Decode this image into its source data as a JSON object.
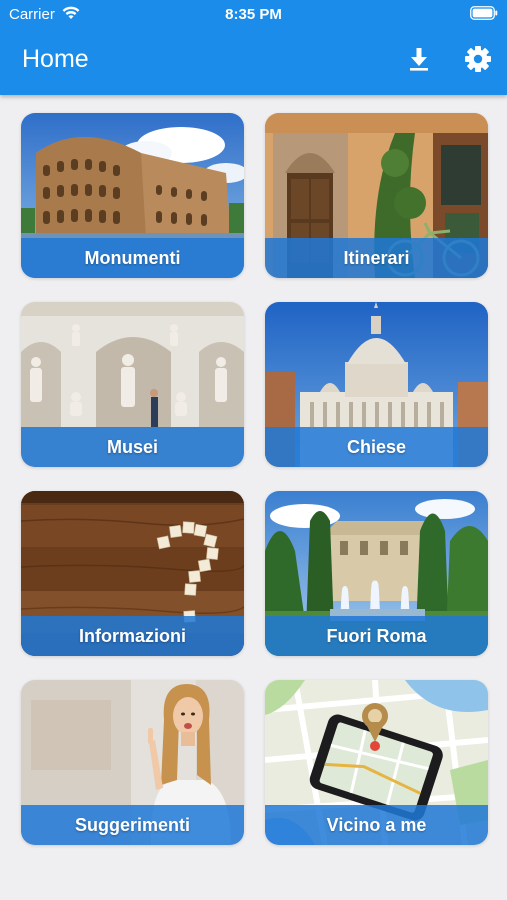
{
  "status_bar": {
    "carrier": "Carrier",
    "time": "8:35 PM"
  },
  "header": {
    "title": "Home",
    "download_icon": "download-icon",
    "settings_icon": "gear-icon"
  },
  "colors": {
    "header": "#1b8ce9",
    "tile_band": "#1e78d7",
    "background": "#efeff1"
  },
  "tiles": [
    {
      "label": "Monumenti",
      "image": "colosseum-image"
    },
    {
      "label": "Itinerari",
      "image": "street-doorway-bicycle-image"
    },
    {
      "label": "Musei",
      "image": "museum-statues-image"
    },
    {
      "label": "Chiese",
      "image": "st-peters-basilica-image"
    },
    {
      "label": "Informazioni",
      "image": "question-mark-wood-image"
    },
    {
      "label": "Fuori Roma",
      "image": "villa-fountains-image"
    },
    {
      "label": "Suggerimenti",
      "image": "woman-pointing-image"
    },
    {
      "label": "Vicino a me",
      "image": "phone-map-image"
    }
  ]
}
